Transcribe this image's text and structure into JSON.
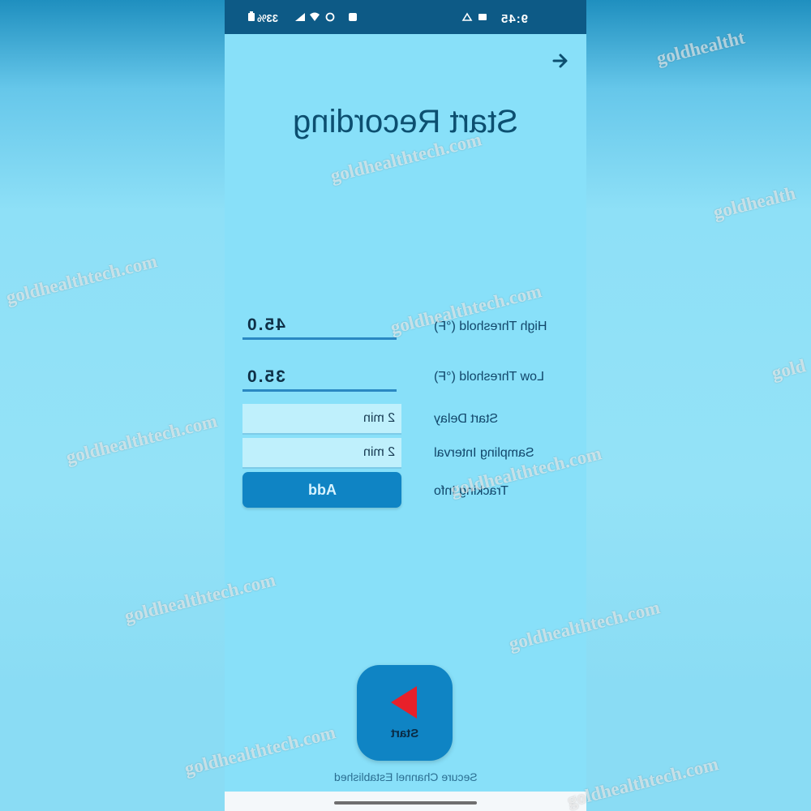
{
  "status_bar": {
    "time": "9:45",
    "battery": "33%"
  },
  "header": {
    "title": "Start Recording"
  },
  "form": {
    "high_threshold": {
      "label": "High Threshold (°F)",
      "value": "45.0"
    },
    "low_threshold": {
      "label": "Low Threshold (°F)",
      "value": "35.0"
    },
    "start_delay": {
      "label": "Start Delay",
      "value": "2 min"
    },
    "sampling_interval": {
      "label": "Sampling Interval",
      "value": "2 min"
    },
    "tracking_info": {
      "label": "Tracking Info",
      "button": "Add"
    }
  },
  "start_button": {
    "label": "Start",
    "icon": "play-icon",
    "icon_color": "#e8202a"
  },
  "footer": {
    "status": "Secure Channel Established"
  },
  "watermark": {
    "text_full": "goldhealthtech.com",
    "text_partial_1": "goldhealtht",
    "text_partial_2": "goldhealth",
    "text_partial_3": "gold"
  },
  "colors": {
    "accent": "#0f84c4",
    "status_bar": "#0d5a86",
    "background": "#88e0f9"
  }
}
